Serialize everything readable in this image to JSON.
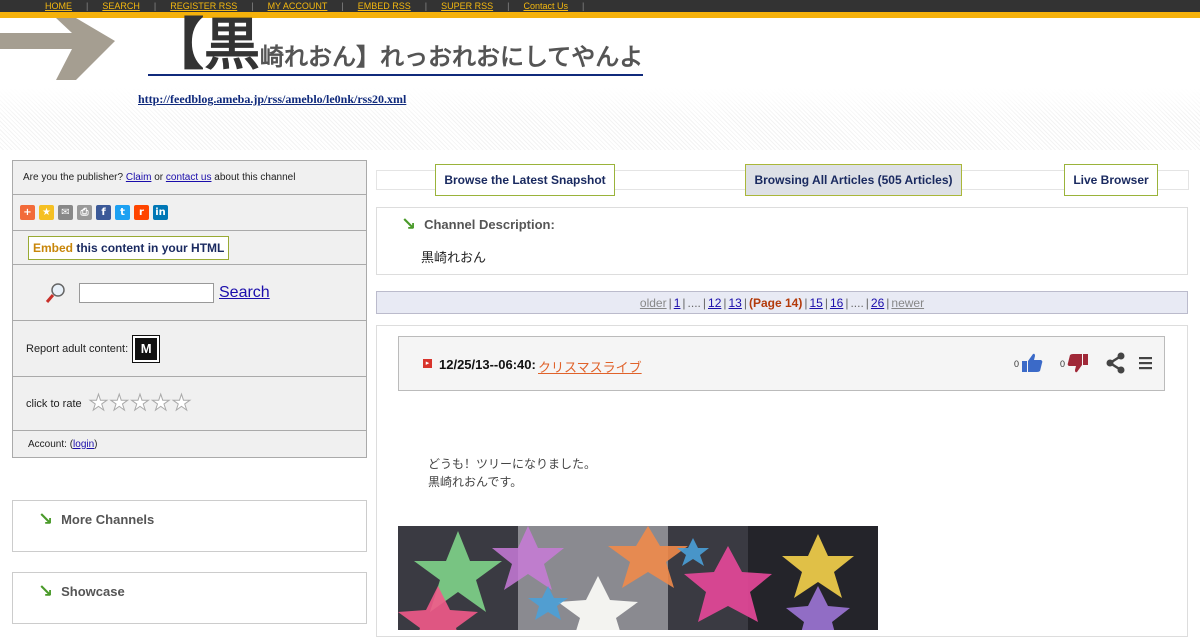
{
  "topnav": {
    "items": [
      "HOME",
      "SEARCH",
      "REGISTER RSS",
      "MY ACCOUNT",
      "EMBED RSS",
      "SUPER RSS",
      "Contact Us"
    ]
  },
  "header": {
    "title_big": "【黒",
    "title_rest": "崎れおん】れっおれおにしてやんよ",
    "feed_url": "http://feedblog.ameba.jp/rss/ameblo/le0nk/rss20.xml"
  },
  "sidebar": {
    "claim_prefix": "Are you the publisher?",
    "claim_link": "Claim",
    "claim_or": "or",
    "contact_link": "contact us",
    "claim_suffix": "about this channel",
    "share_icons": [
      "plus-icon",
      "star-icon",
      "email-icon",
      "print-icon",
      "facebook-icon",
      "twitter-icon",
      "reddit-icon",
      "linkedin-icon"
    ],
    "embed_word": "Embed",
    "embed_rest": "this content in your HTML",
    "search_label": "Search",
    "search_placeholder": "",
    "adult_label": "Report adult content:",
    "mature_badge": "M",
    "rate_label": "click to rate",
    "rating_stars": 5,
    "account_prefix": "Account: (",
    "account_link": "login",
    "account_suffix": ")",
    "more_channels": "More Channels",
    "showcase": "Showcase"
  },
  "tabs": {
    "latest": "Browse the Latest Snapshot",
    "all": "Browsing All Articles (505 Articles)",
    "live": "Live Browser"
  },
  "description": {
    "title": "Channel Description:",
    "text": "黒崎れおん"
  },
  "pager": {
    "older": "older",
    "p1": "1",
    "dots1": "....",
    "p12": "12",
    "p13": "13",
    "current": "(Page 14)",
    "p15": "15",
    "p16": "16",
    "dots2": "....",
    "p26": "26",
    "newer": "newer"
  },
  "article": {
    "date": "12/25/13--06:40:",
    "title": "クリスマスライブ",
    "up_count": "0",
    "down_count": "0",
    "body_line1": "どうも！ツリーになりました。",
    "body_line2": "黒崎れおんです。"
  },
  "colors": {
    "nav_bg": "#333333",
    "nav_link": "#f5b90f",
    "stripe": "#f5b10b",
    "tab_border": "#9ab33a",
    "article_title": "#e0622a",
    "current_page": "#b33a0a"
  }
}
